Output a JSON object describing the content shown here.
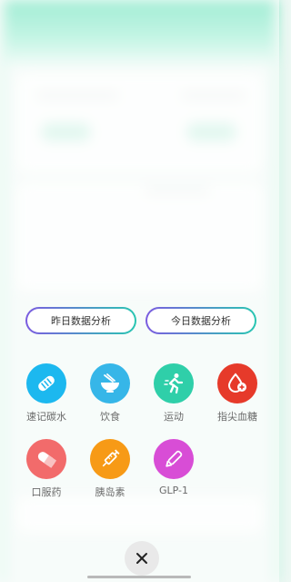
{
  "analysis": {
    "yesterday_label": "昨日数据分析",
    "today_label": "今日数据分析"
  },
  "actions": [
    {
      "label": "速记碳水",
      "icon": "bread-icon",
      "color": "#1cb8ef"
    },
    {
      "label": "饮食",
      "icon": "food-bowl-icon",
      "color": "#36b6e8"
    },
    {
      "label": "运动",
      "icon": "running-icon",
      "color": "#2fcfa9"
    },
    {
      "label": "指尖血糖",
      "icon": "blood-drop-icon",
      "color": "#e63a2a"
    },
    {
      "label": "口服药",
      "icon": "pill-icon",
      "color": "#f26b6b"
    },
    {
      "label": "胰岛素",
      "icon": "syringe-icon",
      "color": "#f79a16"
    },
    {
      "label": "GLP-1",
      "icon": "pen-injector-icon",
      "color": "#d84dd6"
    }
  ],
  "close": {
    "icon": "close-icon"
  }
}
